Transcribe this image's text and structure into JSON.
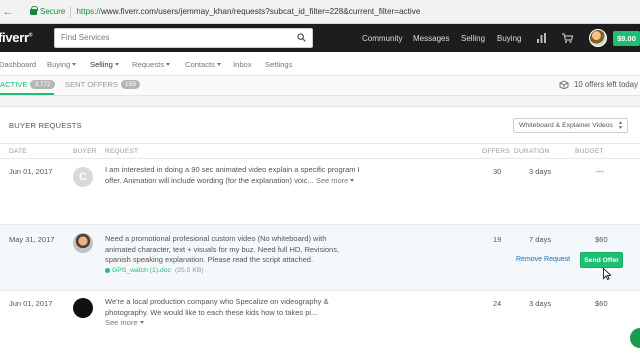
{
  "browser": {
    "secure_label": "Secure",
    "url_scheme": "https://",
    "url_rest": "www.fiverr.com/users/jemmay_khan/requests?subcat_id_filter=228&current_filter=active"
  },
  "header": {
    "logo": "fiverr",
    "search_placeholder": "Find Services",
    "nav": [
      "Community",
      "Messages",
      "Selling",
      "Buying"
    ],
    "balance": "$9.00",
    "brand_color": "#1dbf73"
  },
  "subnav": {
    "items": [
      {
        "label": "Dashboard"
      },
      {
        "label": "Buying"
      },
      {
        "label": "Selling"
      },
      {
        "label": "Requests"
      },
      {
        "label": "Contacts"
      },
      {
        "label": "Inbox"
      },
      {
        "label": "Settings"
      }
    ]
  },
  "tabs": {
    "active_label": "ACTIVE",
    "active_count": "3,772",
    "sent_label": "SENT OFFERS",
    "sent_count": "159",
    "offers_left": "10 offers left today"
  },
  "panel": {
    "title": "BUYER REQUESTS",
    "category_select": "Whiteboard & Explainer Videos",
    "columns": {
      "date": "DATE",
      "buyer": "BUYER",
      "request": "REQUEST",
      "offers": "OFFERS",
      "duration": "DURATION",
      "budget": "BUDGET"
    }
  },
  "rows": [
    {
      "date": "Jun 01, 2017",
      "buyer_initial": "C",
      "request": "I am interested in doing a 90 sec animated video explain a specific program I offer. Animation will include wording (for the explanation) voic...",
      "see_more": "See more",
      "offers": "30",
      "duration": "3 days",
      "budget": "---"
    },
    {
      "date": "May 31, 2017",
      "request": "Need a promotional profesional custom video (No whiteboard) with animated character, text + visuals for my buz. Need full HD, Revisions, spanish speaking explanation. Please read the script attached.",
      "attachment": "GPS_watch (1).doc",
      "attachment_size": "(25.5 KB)",
      "offers": "19",
      "duration": "7 days",
      "budget": "$60",
      "remove_label": "Remove Request",
      "send_label": "Send Offer"
    },
    {
      "date": "Jun 01, 2017",
      "request": "We're a local production company who Specalize on videography & photography. We would like to each these kids how to takes pi...",
      "see_more": "See more",
      "offers": "24",
      "duration": "3 days",
      "budget": "$60"
    }
  ]
}
